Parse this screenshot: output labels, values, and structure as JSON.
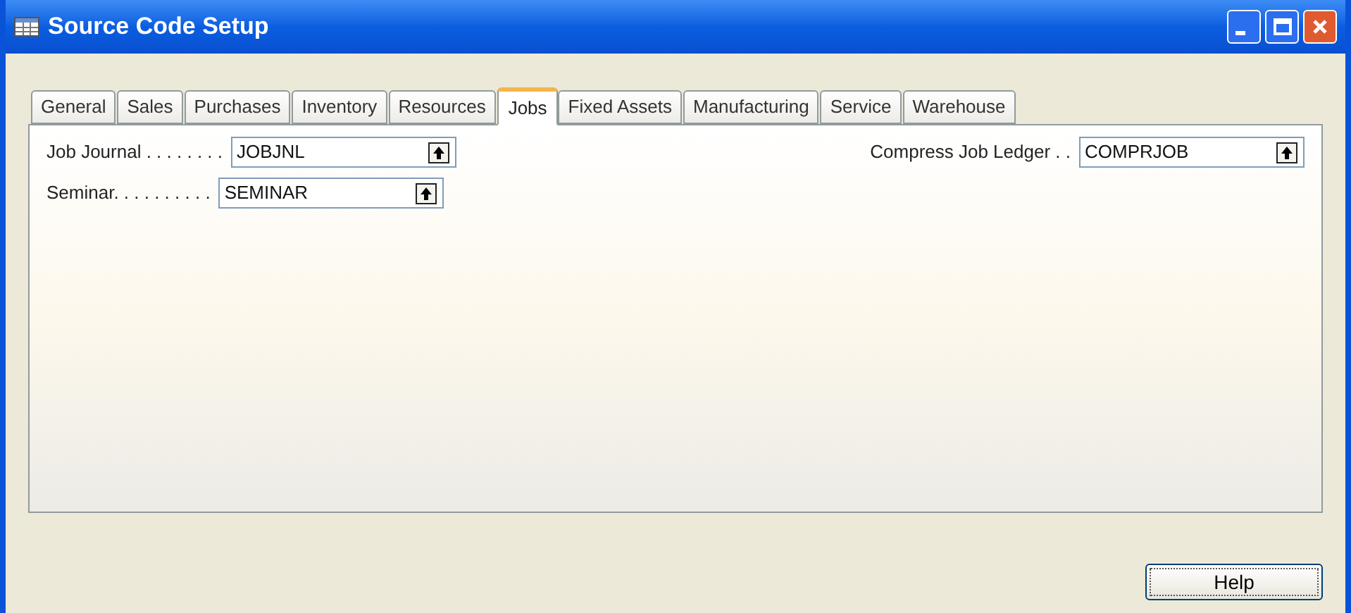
{
  "window": {
    "title": "Source Code Setup"
  },
  "tabs": [
    {
      "label": "General",
      "selected": false
    },
    {
      "label": "Sales",
      "selected": false
    },
    {
      "label": "Purchases",
      "selected": false
    },
    {
      "label": "Inventory",
      "selected": false
    },
    {
      "label": "Resources",
      "selected": false
    },
    {
      "label": "Jobs",
      "selected": true
    },
    {
      "label": "Fixed Assets",
      "selected": false
    },
    {
      "label": "Manufacturing",
      "selected": false
    },
    {
      "label": "Service",
      "selected": false
    },
    {
      "label": "Warehouse",
      "selected": false
    }
  ],
  "left_fields": [
    {
      "label": "Job Journal . . . . . . . .",
      "value": "JOBJNL"
    },
    {
      "label": "Seminar. . . . . . . . . .",
      "value": "SEMINAR"
    }
  ],
  "right_fields": [
    {
      "label": "Compress Job Ledger . .",
      "value": "COMPRJOB"
    }
  ],
  "buttons": [
    "Help"
  ]
}
